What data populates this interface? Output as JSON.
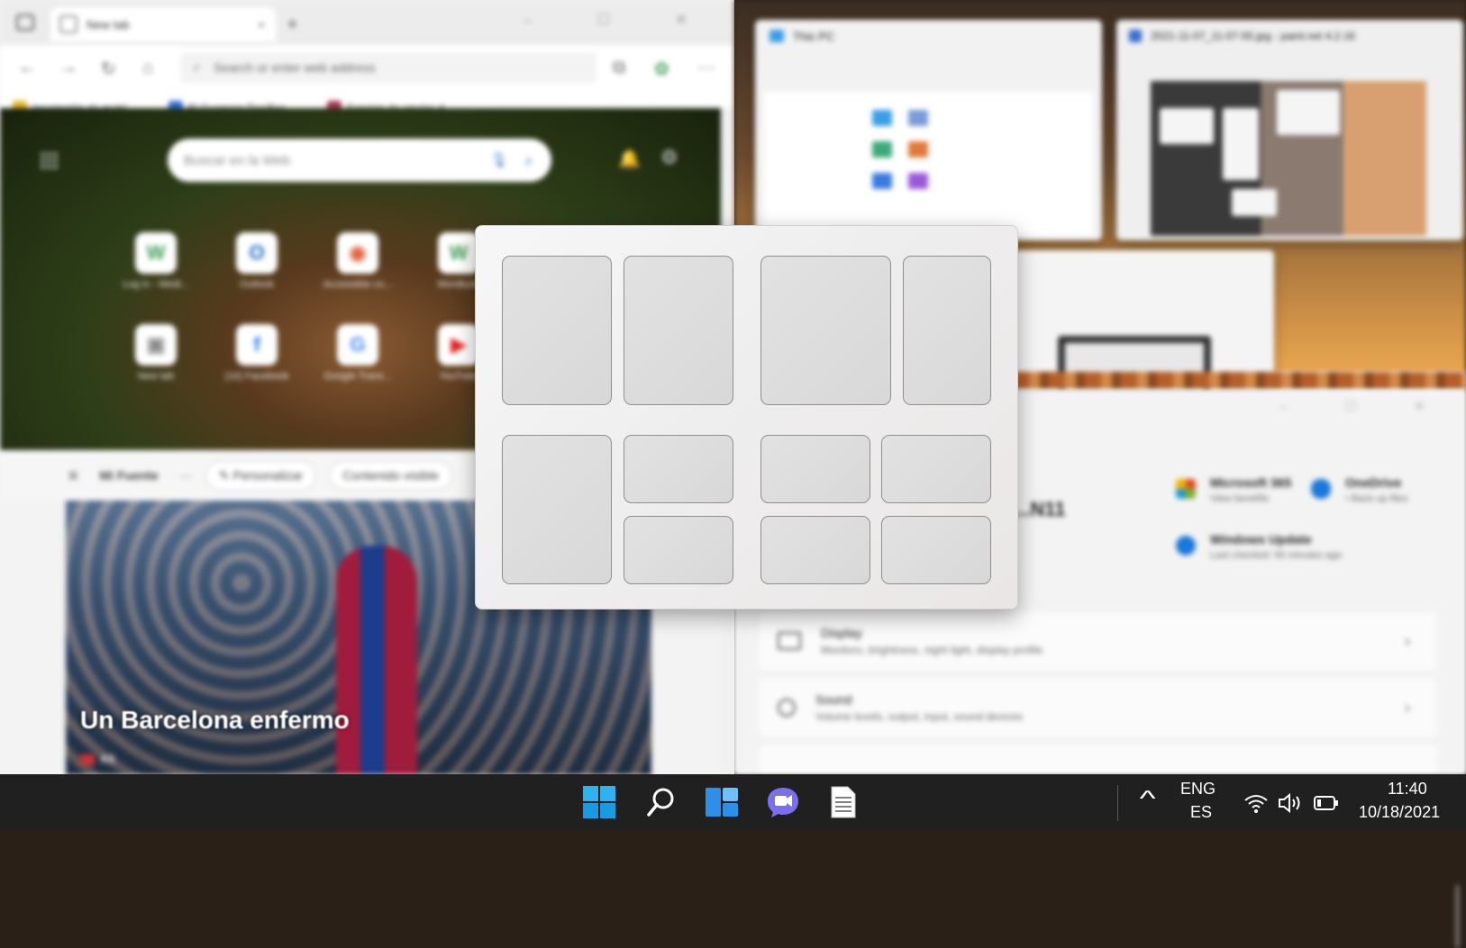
{
  "edge": {
    "tab_title": "New tab",
    "close_tab": "×",
    "new_tab": "+",
    "window_controls": "– ☐ ✕",
    "address_placeholder": "Search or enter web address",
    "favorites": [
      {
        "label": "Inscripción de matrí...",
        "color": "#e6b422"
      },
      {
        "label": "El Guerrero Pacífico...",
        "color": "#2f6fd8"
      },
      {
        "label": "Servicio de envíos d...",
        "color": "#b03050"
      }
    ],
    "search_placeholder": "Buscar en la Web",
    "tiles": [
      {
        "label": "Log in - Wedi...",
        "glyph": "W",
        "color": "#3a9a50"
      },
      {
        "label": "Outlook",
        "glyph": "O",
        "color": "#1466c0"
      },
      {
        "label": "Accessible co...",
        "glyph": "◉",
        "color": "#e0603a"
      },
      {
        "label": "Wordtune",
        "glyph": "W",
        "color": "#3a9a50"
      },
      {
        "label": "New tab",
        "glyph": "▣",
        "color": "#888888"
      },
      {
        "label": "(10) Facebook",
        "glyph": "f",
        "color": "#1877f2"
      },
      {
        "label": "Google Trans...",
        "glyph": "G",
        "color": "#4285f4"
      },
      {
        "label": "YouTube",
        "glyph": "▶",
        "color": "#e02020"
      }
    ],
    "feed_label": "Mi Fuente",
    "feed_more": "···",
    "personalize": "Personalizar",
    "content_visible": "Contenido visible",
    "news_title": "Un Barcelona enfermo",
    "news_source": "AS"
  },
  "desktop": {
    "thispc_title": "This PC",
    "paint_title": "2021-11-07_11-07-55.jpg - paint.net 4.2.16"
  },
  "settings": {
    "window_controls": "– ☐ ✕",
    "device_name": "...N11",
    "quick": [
      {
        "name": "Microsoft 365",
        "sub": "View benefits",
        "color": "#e04a20"
      },
      {
        "name": "OneDrive",
        "sub": "• Back up files",
        "color": "#1a78d8"
      },
      {
        "name": "Windows Update",
        "sub": "Last checked: 56 minutes ago",
        "color": "#1a78d8"
      }
    ],
    "rows": [
      {
        "name": "Display",
        "sub": "Monitors, brightness, night light, display profile"
      },
      {
        "name": "Sound",
        "sub": "Volume levels, output, input, sound devices"
      }
    ],
    "chevron": "›"
  },
  "taskbar": {
    "lang_top": "ENG",
    "lang_bottom": "ES",
    "time": "11:40",
    "date": "10/18/2021",
    "chevron_up": "^"
  },
  "colors": {
    "accent": "#0078d4",
    "taskbar_bg": "#202020",
    "snap_border": "#8f8f8f"
  }
}
